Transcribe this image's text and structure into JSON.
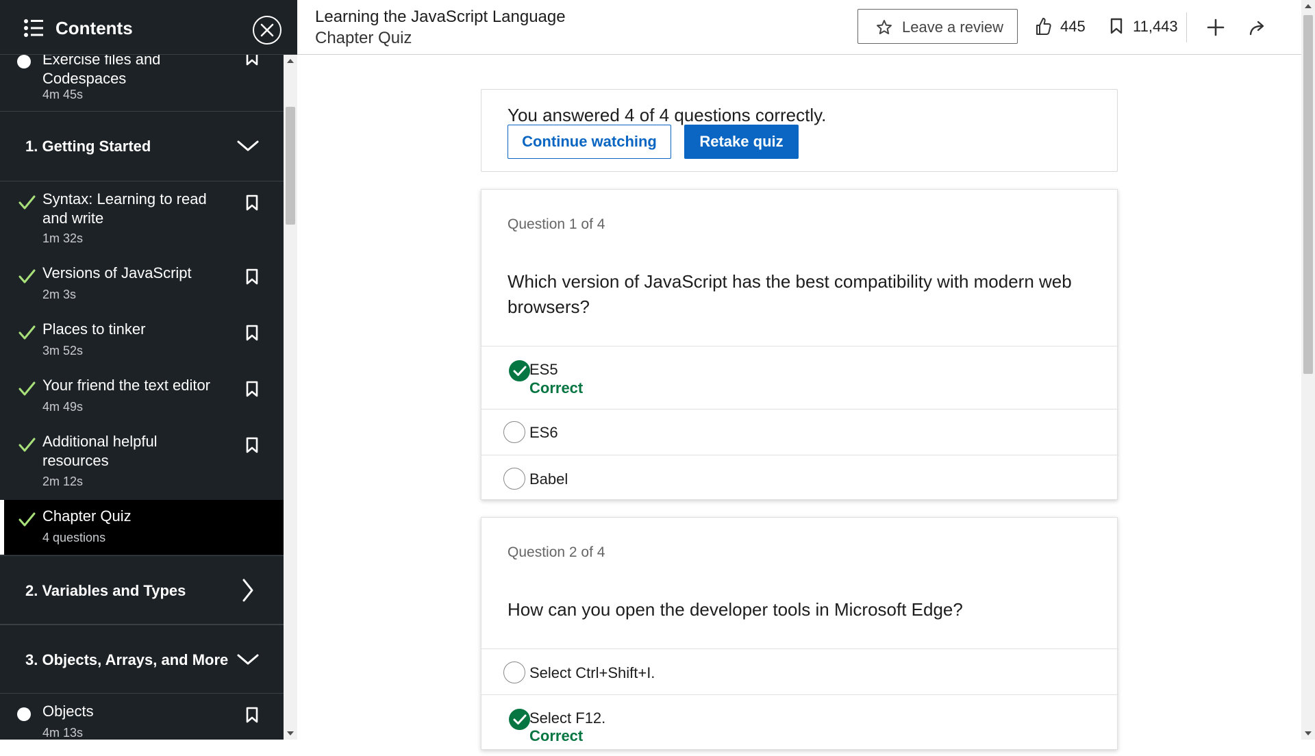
{
  "sidebar": {
    "title": "Contents",
    "intro_item": {
      "title": "Exercise files and Codespaces",
      "duration": "4m 45s",
      "status": "in-progress"
    },
    "sections": [
      {
        "title": "1. Getting Started",
        "expanded": true
      },
      {
        "title": "2. Variables and Types",
        "expanded": false
      },
      {
        "title": "3. Objects, Arrays, and More",
        "expanded": true
      }
    ],
    "items": [
      {
        "title": "Syntax: Learning to read and write",
        "duration": "1m 32s",
        "status": "completed"
      },
      {
        "title": "Versions of JavaScript",
        "duration": "2m 3s",
        "status": "completed"
      },
      {
        "title": "Places to tinker",
        "duration": "3m 52s",
        "status": "completed"
      },
      {
        "title": "Your friend the text editor",
        "duration": "4m 49s",
        "status": "completed"
      },
      {
        "title": "Additional helpful resources",
        "duration": "2m 12s",
        "status": "completed"
      },
      {
        "title": "Chapter Quiz",
        "duration": "4 questions",
        "status": "completed",
        "active": true
      }
    ],
    "section3_items": [
      {
        "title": "Objects",
        "duration": "4m 13s",
        "status": "in-progress"
      }
    ]
  },
  "header": {
    "course_title": "Learning the JavaScript Language",
    "chapter_title": "Chapter Quiz",
    "review_label": "Leave a review",
    "likes": "445",
    "saves": "11,443"
  },
  "summary": {
    "result_text": "You answered 4 of 4 questions correctly.",
    "continue_label": "Continue watching",
    "retake_label": "Retake quiz"
  },
  "questions": [
    {
      "number": "Question 1 of 4",
      "text": "Which version of JavaScript has the best compatibility with modern web browsers?",
      "options": [
        {
          "text": "ES5",
          "selected": true,
          "feedback": "Correct"
        },
        {
          "text": "ES6",
          "selected": false
        },
        {
          "text": "Babel",
          "selected": false
        }
      ]
    },
    {
      "number": "Question 2 of 4",
      "text": "How can you open the developer tools in Microsoft Edge?",
      "options": [
        {
          "text": "Select Ctrl+Shift+I.",
          "selected": false
        },
        {
          "text": "Select F12.",
          "selected": true,
          "feedback": "Correct"
        }
      ]
    }
  ],
  "colors": {
    "sidebar_bg": "#1d2226",
    "check_green": "#a8e07a",
    "correct_green": "#057642",
    "primary_blue": "#0a66c2"
  }
}
